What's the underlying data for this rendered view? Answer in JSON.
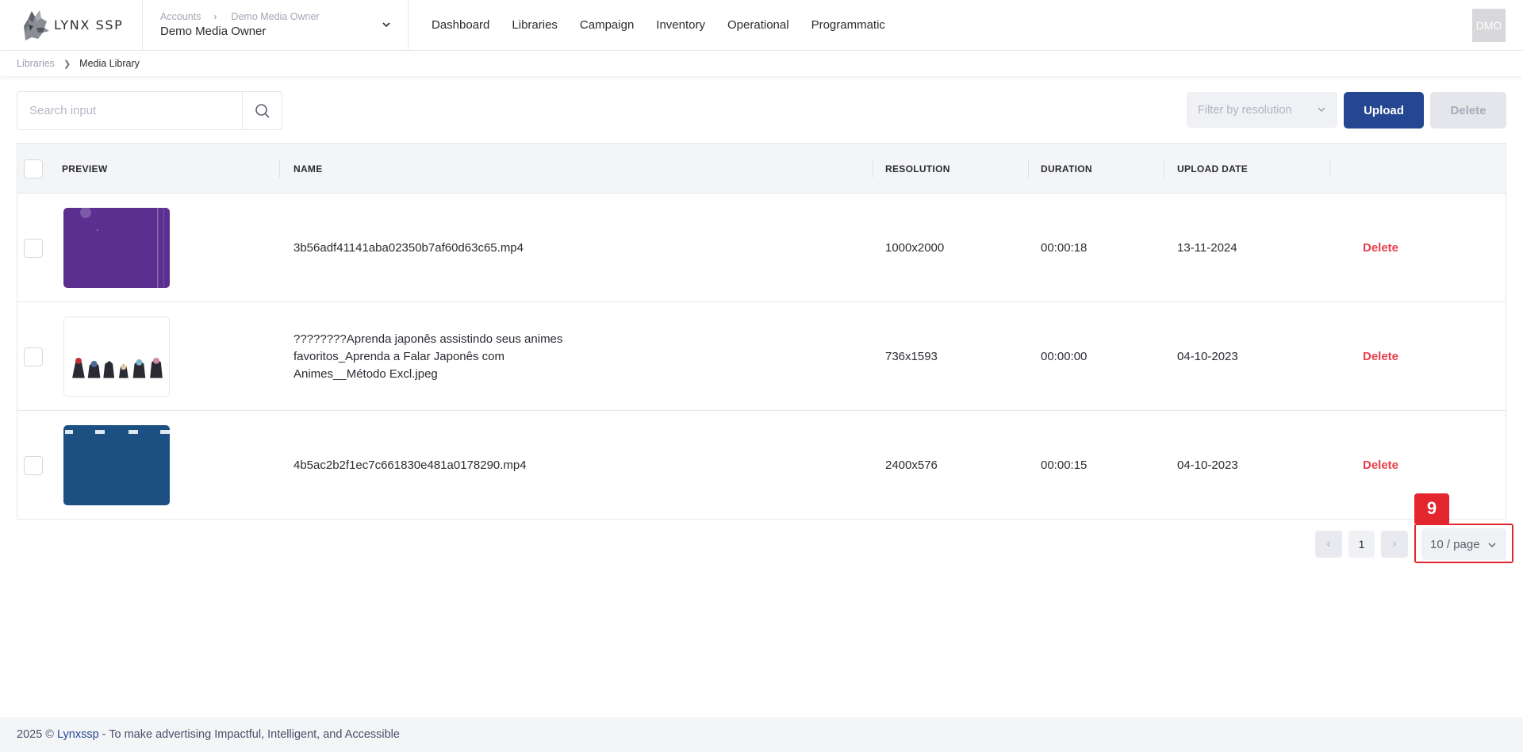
{
  "app": {
    "logo_text": "LYNX SSP"
  },
  "account": {
    "crumb_parent": "Accounts",
    "crumb_child": "Demo Media Owner",
    "name": "Demo Media Owner"
  },
  "nav": {
    "items": [
      {
        "label": "Dashboard"
      },
      {
        "label": "Libraries"
      },
      {
        "label": "Campaign"
      },
      {
        "label": "Inventory"
      },
      {
        "label": "Operational"
      },
      {
        "label": "Programmatic"
      }
    ]
  },
  "user": {
    "avatar_initials": "DMO"
  },
  "breadcrumb": {
    "parent": "Libraries",
    "current": "Media Library"
  },
  "toolbar": {
    "search_placeholder": "Search input",
    "filter_placeholder": "Filter by resolution",
    "upload_label": "Upload",
    "delete_label": "Delete"
  },
  "table": {
    "columns": [
      "PREVIEW",
      "NAME",
      "RESOLUTION",
      "DURATION",
      "UPLOAD DATE"
    ],
    "rows": [
      {
        "name": "3b56adf41141aba02350b7af60d63c65.mp4",
        "resolution": "1000x2000",
        "duration": "00:00:18",
        "upload_date": "13-11-2024",
        "action": "Delete",
        "thumb_color": "#5a2f8f"
      },
      {
        "name": "????????Aprenda japonês assistindo seus animes favoritos_Aprenda a Falar Japonês com Animes__Método Excl.jpeg",
        "resolution": "736x1593",
        "duration": "00:00:00",
        "upload_date": "04-10-2023",
        "action": "Delete",
        "thumb_color": "#ffffff"
      },
      {
        "name": "4b5ac2b2f1ec7c661830e481a0178290.mp4",
        "resolution": "2400x576",
        "duration": "00:00:15",
        "upload_date": "04-10-2023",
        "action": "Delete",
        "thumb_color": "#1c4f82"
      }
    ]
  },
  "pagination": {
    "current_page": "1",
    "page_size": "10 / page"
  },
  "annotation": {
    "label": "9"
  },
  "footer": {
    "prefix": "2025 ©",
    "brand": "Lynxssp",
    "suffix": "- To make advertising Impactful, Intelligent, and Accessible"
  },
  "colors": {
    "primary": "#254691",
    "danger": "#e8404a",
    "annotation": "#e3262d"
  }
}
